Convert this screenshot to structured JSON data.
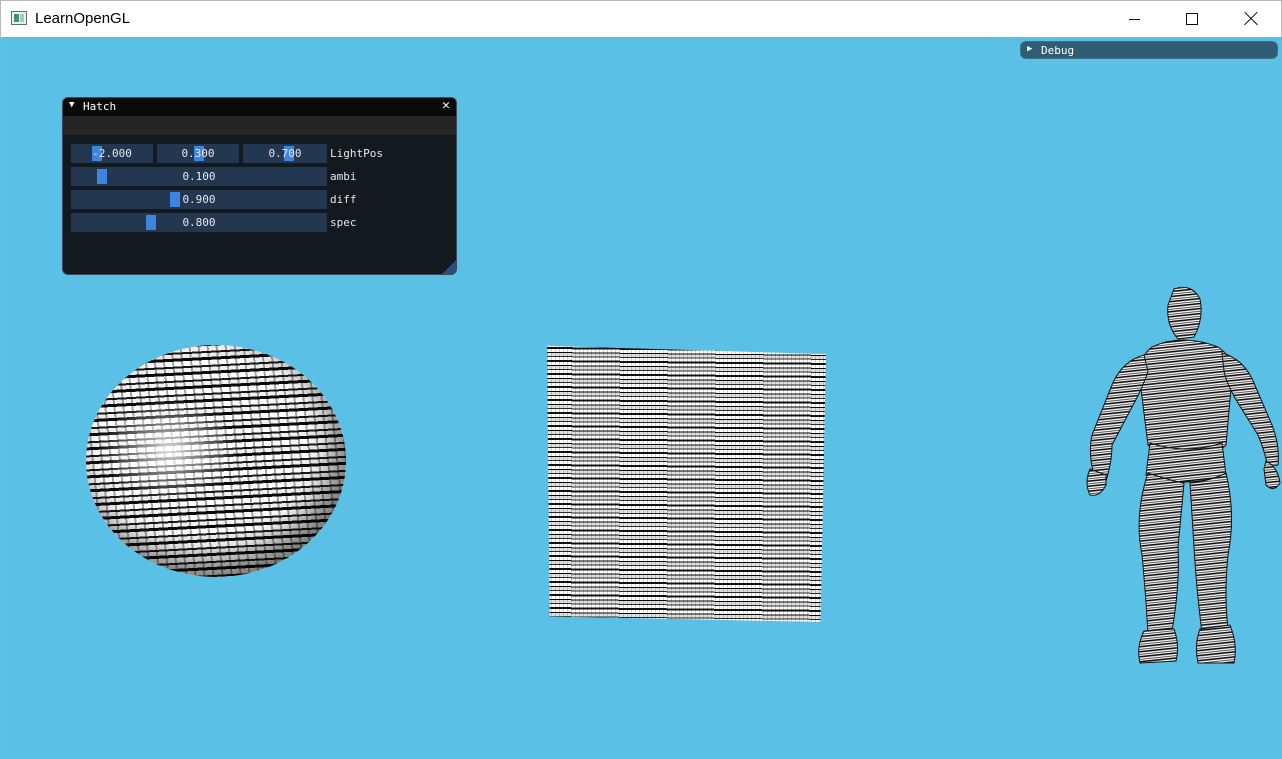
{
  "window": {
    "title": "LearnOpenGL",
    "controls": [
      "minimize",
      "maximize",
      "close"
    ]
  },
  "debug_window": {
    "title": "Debug",
    "collapsed": true
  },
  "hatch_window": {
    "title": "Hatch",
    "light_pos": {
      "label": "LightPos",
      "x": "-2.000",
      "y": "0.300",
      "z": "0.700"
    },
    "ambi": {
      "label": "ambi",
      "value": "0.100",
      "fraction": 0.1
    },
    "diff": {
      "label": "diff",
      "value": "0.900",
      "fraction": 0.45
    },
    "spec": {
      "label": "spec",
      "value": "0.800",
      "fraction": 0.3
    }
  },
  "scene": {
    "background_color": "#5bc0e6",
    "objects": [
      "hatched-sphere",
      "hatched-cube",
      "hatched-character"
    ]
  }
}
